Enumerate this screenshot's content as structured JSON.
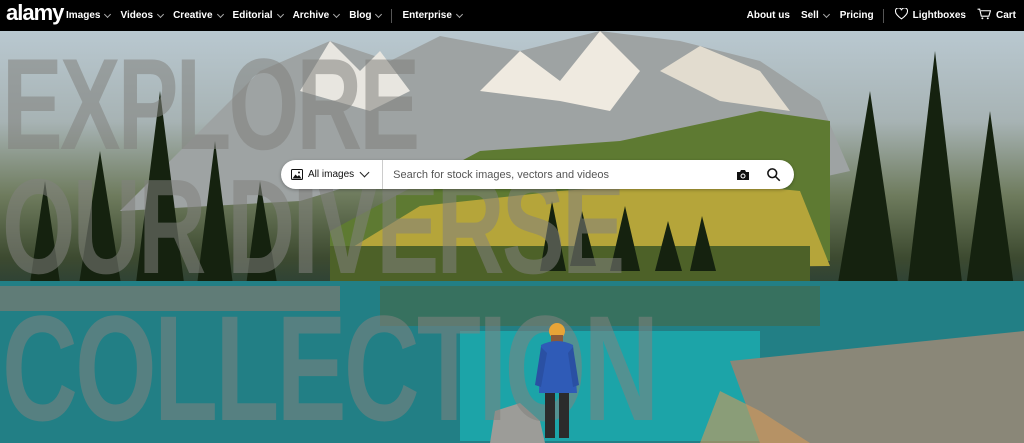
{
  "brand": {
    "logo_text": "alamy"
  },
  "nav": {
    "left": [
      {
        "label": "Images"
      },
      {
        "label": "Videos"
      },
      {
        "label": "Creative"
      },
      {
        "label": "Editorial"
      },
      {
        "label": "Archive"
      },
      {
        "label": "Blog"
      },
      {
        "label": "Enterprise"
      }
    ],
    "right": {
      "about": "About us",
      "sell": "Sell",
      "pricing": "Pricing",
      "lightboxes": "Lightboxes",
      "cart": "Cart"
    }
  },
  "hero": {
    "overlay_lines": [
      "EXPLORE",
      "OUR DIVERSE",
      "COLLECTION"
    ]
  },
  "search": {
    "category": "All images",
    "placeholder": "Search for stock images, vectors and videos",
    "icons": [
      "image-icon",
      "camera-icon",
      "search-icon"
    ]
  },
  "colors": {
    "topbar_bg": "#000000",
    "search_bg": "#ffffff",
    "overlay_text": "#82827d"
  }
}
